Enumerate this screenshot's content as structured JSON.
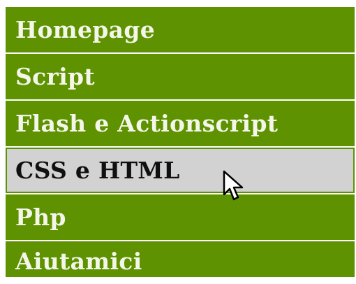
{
  "menu": {
    "items": [
      {
        "label": "Homepage",
        "active": false
      },
      {
        "label": "Script",
        "active": false
      },
      {
        "label": "Flash e Actionscript",
        "active": false
      },
      {
        "label": "CSS e HTML",
        "active": true
      },
      {
        "label": "Php",
        "active": false
      },
      {
        "label": "Aiutamici",
        "active": false
      }
    ]
  },
  "colors": {
    "item_background": "#5e9200",
    "item_text": "#f4f6ea",
    "active_background": "#d2d2d2",
    "active_text": "#101010"
  },
  "icons": {
    "pointer": "mouse-pointer-icon"
  }
}
